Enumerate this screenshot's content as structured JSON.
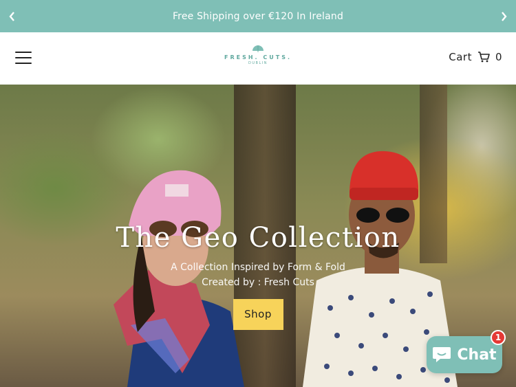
{
  "announcement": {
    "text": "Free Shipping over €120 In Ireland",
    "prev_icon": "chevron-left-icon",
    "next_icon": "chevron-right-icon"
  },
  "header": {
    "menu_icon": "hamburger-icon",
    "logo": {
      "brand": "FRESH. CUTS.",
      "city": "DUBLIN"
    },
    "cart_label": "Cart",
    "cart_icon": "shopping-cart-icon",
    "cart_count": "0"
  },
  "hero": {
    "title": "The Geo Collection",
    "subtitle": "A Collection Inspired by Form & Fold",
    "credit": "Created by : Fresh Cuts",
    "button_label": "Shop"
  },
  "chat": {
    "label": "Chat",
    "badge": "1",
    "icon": "chat-bubble-icon"
  },
  "colors": {
    "accent": "#7fbfb6",
    "button": "#f7d35a",
    "badge": "#e53935"
  }
}
